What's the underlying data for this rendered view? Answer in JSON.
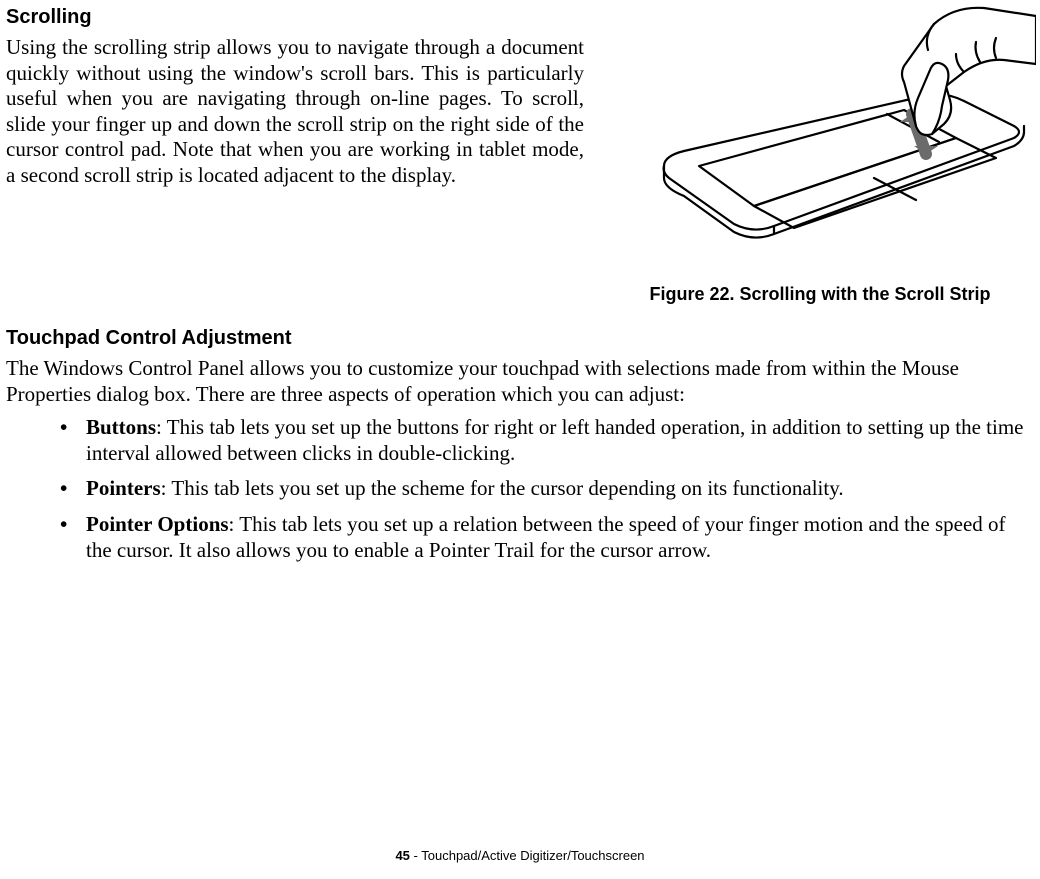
{
  "scrolling": {
    "heading": "Scrolling",
    "body": "Using the scrolling strip allows you to navigate through a document quickly without using the window's scroll bars. This is particularly useful when you are navigating through on-line pages. To scroll, slide your finger up and down the scroll strip on the right side of the cursor control pad. Note that when you are working in tablet mode, a second scroll strip is located adjacent to the display."
  },
  "figure": {
    "caption_prefix": "Figure 22.  ",
    "caption_title": "Scrolling with the Scroll Strip"
  },
  "touchpad": {
    "heading": "Touchpad Control Adjustment",
    "intro": "The Windows Control Panel allows you to customize your touchpad with selections made from within the Mouse Properties dialog box. There are three aspects of operation which you can adjust:",
    "items": [
      {
        "label": "Buttons",
        "text": ": This tab lets you set up the buttons for right or left handed operation, in addition to setting up the time interval allowed between clicks in double-clicking."
      },
      {
        "label": "Pointers",
        "text": ": This tab lets you set up the scheme for the cursor depending on its functionality."
      },
      {
        "label": "Pointer Options",
        "text": ": This tab lets you set up a relation between the speed of your finger motion and the speed of the cursor. It also allows you to enable a Pointer Trail for the cursor arrow."
      }
    ]
  },
  "footer": {
    "page": "45",
    "sep": " - ",
    "title": "Touchpad/Active Digitizer/Touchscreen"
  }
}
